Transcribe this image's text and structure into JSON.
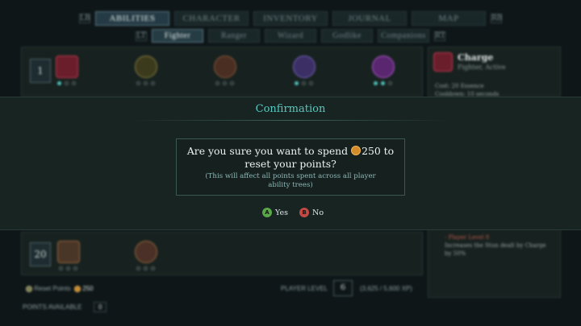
{
  "top_tabs": {
    "left_bumper": "LB",
    "right_bumper": "RB",
    "items": [
      {
        "label": "ABILITIES",
        "active": true
      },
      {
        "label": "CHARACTER",
        "active": false
      },
      {
        "label": "INVENTORY",
        "active": false
      },
      {
        "label": "JOURNAL",
        "active": false
      },
      {
        "label": "MAP",
        "active": false
      }
    ]
  },
  "sub_tabs": {
    "left_bumper": "LT",
    "right_bumper": "RT",
    "items": [
      {
        "label": "Fighter",
        "active": true
      },
      {
        "label": "Ranger",
        "active": false
      },
      {
        "label": "Wizard",
        "active": false
      },
      {
        "label": "Godlike",
        "active": false
      },
      {
        "label": "Companions",
        "active": false
      }
    ]
  },
  "tree_top": {
    "tier_number": "1"
  },
  "tree_bottom": {
    "tier_number": "20"
  },
  "info_panel": {
    "title": "Charge",
    "subtitle": "Fighter, Active",
    "cost": "Cost: 20 Essence",
    "cooldown": "Cooldown: 10 seconds",
    "upgrade_heading": "- Player Level 8",
    "upgrade_text_1": "Increases the Stun dealt by Charge",
    "upgrade_text_2": "by 50%"
  },
  "footer": {
    "reset_label": "Reset Points",
    "reset_cost": "250",
    "player_level_label": "PLAYER LEVEL",
    "player_level": "6",
    "xp": "(3,625 / 5,600 XP)",
    "points_label": "POINTS AVAILABLE",
    "points_value": "0"
  },
  "modal": {
    "title": "Confirmation",
    "message_pre": "Are you sure you want to spend",
    "amount": "250",
    "message_post": "to",
    "message_line2": "reset your points?",
    "note_line1": "(This will affect all points spent across all player",
    "note_line2": "ability trees)",
    "yes_glyph": "A",
    "yes_label": "Yes",
    "no_glyph": "B",
    "no_label": "No"
  },
  "colors": {
    "accent_teal": "#57c9c0",
    "confirm_green": "#5aa74a",
    "cancel_red": "#c24a45",
    "coin_gold": "#d48b2a"
  }
}
